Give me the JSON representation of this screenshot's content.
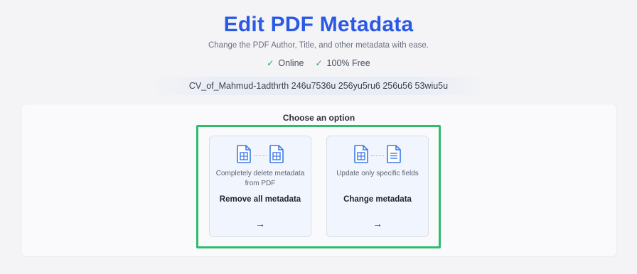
{
  "header": {
    "title": "Edit PDF Metadata",
    "subtitle": "Change the PDF Author, Title, and other metadata with ease.",
    "features": [
      {
        "icon": "check-icon",
        "label": "Online"
      },
      {
        "icon": "check-icon",
        "label": "100% Free"
      }
    ]
  },
  "file": {
    "name": "CV_of_Mahmud-1adthrth 246u7536u 256yu5ru6 256u56 53wiu5u"
  },
  "options": {
    "heading": "Choose an option",
    "cards": [
      {
        "description": "Completely delete metadata from PDF",
        "action": "Remove all metadata",
        "arrow": "→",
        "icons": [
          "pdf-doc-icon",
          "pdf-doc-icon"
        ]
      },
      {
        "description": "Update only specific fields",
        "action": "Change metadata",
        "arrow": "→",
        "icons": [
          "pdf-doc-icon",
          "text-doc-icon"
        ]
      }
    ]
  },
  "colors": {
    "title": "#2b59e6",
    "highlight_border": "#2ebc6c",
    "check": "#22a35a",
    "icon": "#3d7be8"
  }
}
